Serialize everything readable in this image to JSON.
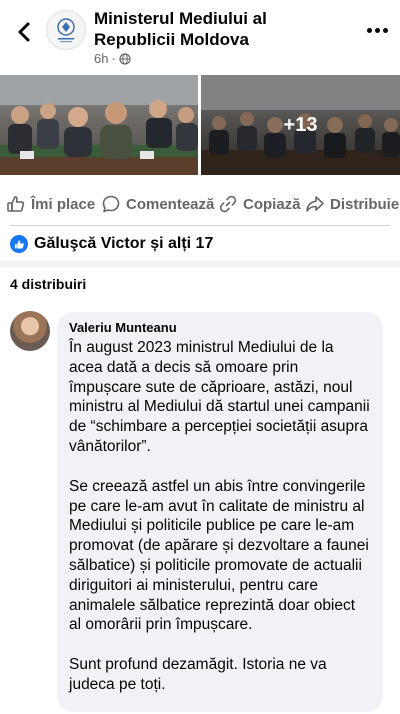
{
  "header": {
    "page_name": "Ministerul Mediului al Republicii Moldova",
    "time": "6h",
    "audience_icon": "globe-icon"
  },
  "photos": {
    "more_count": "+13"
  },
  "actions": {
    "like": "Îmi place",
    "comment": "Comentează",
    "copy": "Copiază",
    "share": "Distribuie"
  },
  "reactions": {
    "text": "Găluşcă Victor și alți 17"
  },
  "shares": {
    "text": "4 distribuiri"
  },
  "comment": {
    "author": "Valeriu Munteanu",
    "paragraphs": [
      "În august 2023 ministrul Mediului de la acea dată a decis să omoare prin împușcare sute de căprioare, astăzi, noul ministru al Mediului dă startul unei campanii de “schimbare a percepției societății asupra vânătorilor”.",
      "Se creează astfel un abis între convingerile pe care le-am avut în calitate de ministru al Mediului și politicile publice pe care le-am promovat (de apărare și dezvoltare a faunei sălbatice) și politicile promovate de actualii diriguitori ai ministerului, pentru care animalele sălbatice reprezintă doar obiect al omorârii prin împușcare.",
      "Sunt profund dezamăgit. Istoria ne va judeca pe toți."
    ]
  },
  "colors": {
    "brand_blue": "#1877f2",
    "secondary_text": "#65676b",
    "bubble_bg": "#f0f2f5"
  }
}
